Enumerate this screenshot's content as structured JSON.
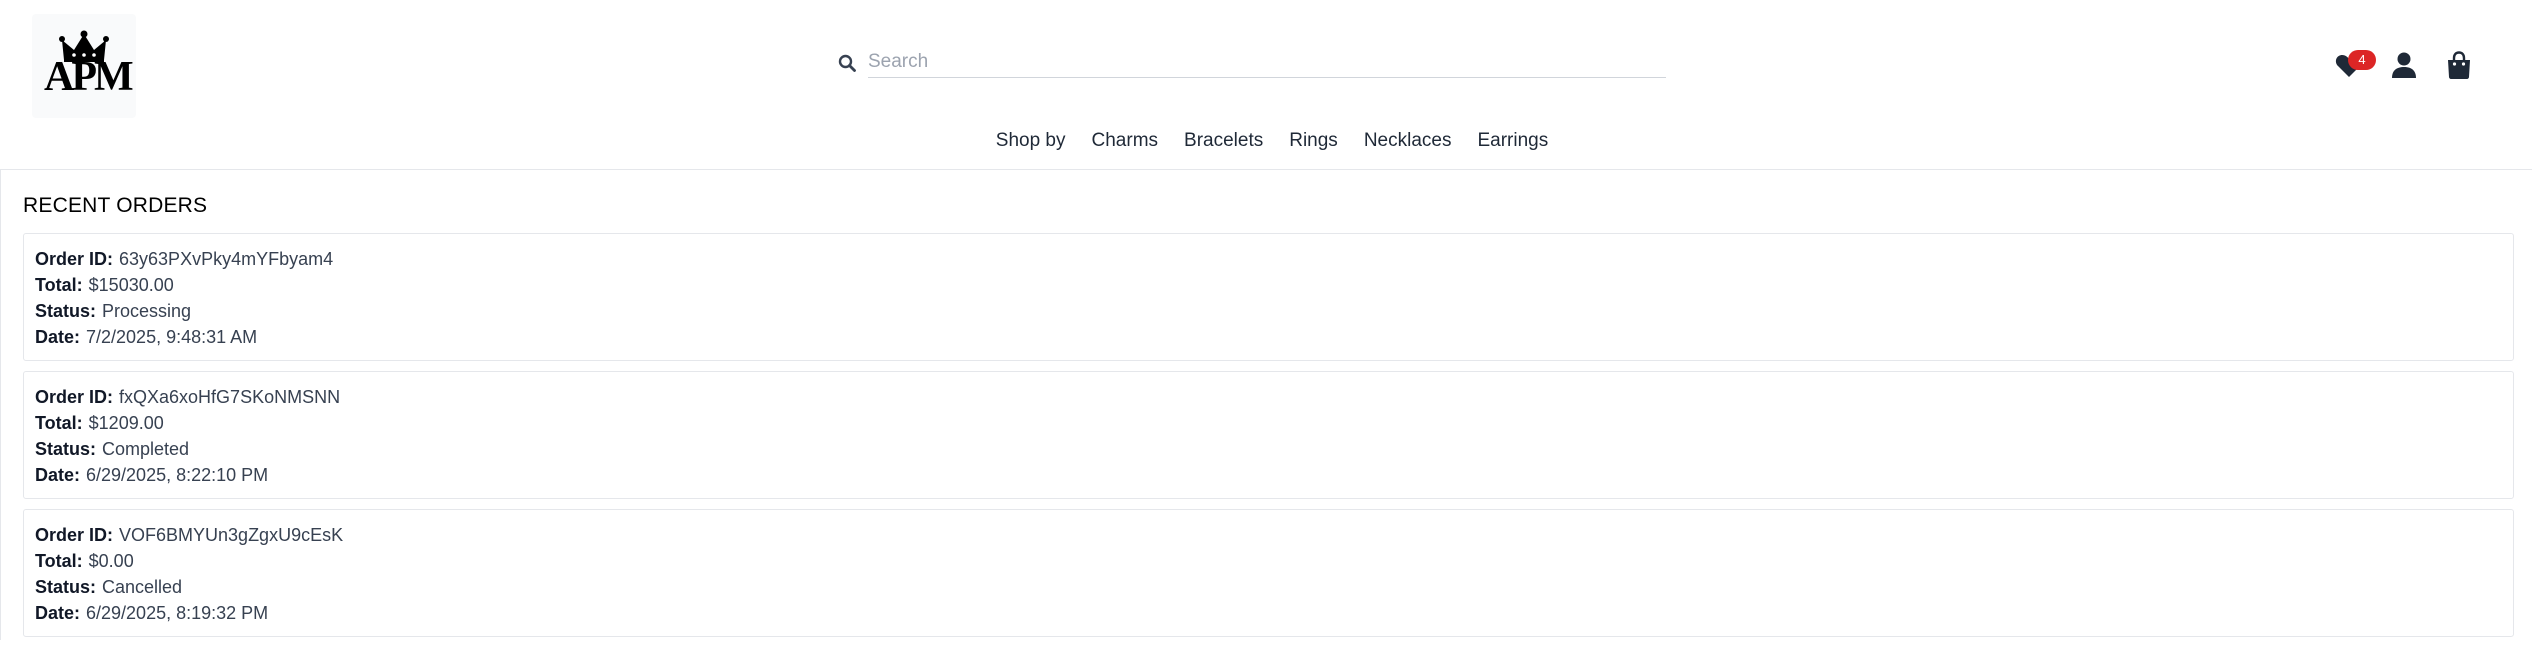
{
  "header": {
    "logo_text": "APM",
    "search": {
      "placeholder": "Search",
      "value": ""
    },
    "wishlist_count": "4",
    "icons": [
      "heart-icon",
      "user-icon",
      "shopping-bag-icon",
      "search-icon",
      "crown-icon"
    ]
  },
  "nav": {
    "items": [
      "Shop by",
      "Charms",
      "Bracelets",
      "Rings",
      "Necklaces",
      "Earrings"
    ]
  },
  "orders_section": {
    "title": "RECENT ORDERS",
    "labels": {
      "order_id": "Order ID:",
      "total": "Total:",
      "status": "Status:",
      "date": "Date:"
    },
    "orders": [
      {
        "order_id": "63y63PXvPky4mYFbyam4",
        "total": "$15030.00",
        "status": "Processing",
        "date": "7/2/2025, 9:48:31 AM"
      },
      {
        "order_id": "fxQXa6xoHfG7SKoNMSNN",
        "total": "$1209.00",
        "status": "Completed",
        "date": "6/29/2025, 8:22:10 PM"
      },
      {
        "order_id": "VOF6BMYUn3gZgxU9cEsK",
        "total": "$0.00",
        "status": "Cancelled",
        "date": "6/29/2025, 8:19:32 PM"
      }
    ]
  },
  "colors": {
    "badge": "#dc2626",
    "icon": "#1f2937",
    "border": "#e5e7eb"
  }
}
